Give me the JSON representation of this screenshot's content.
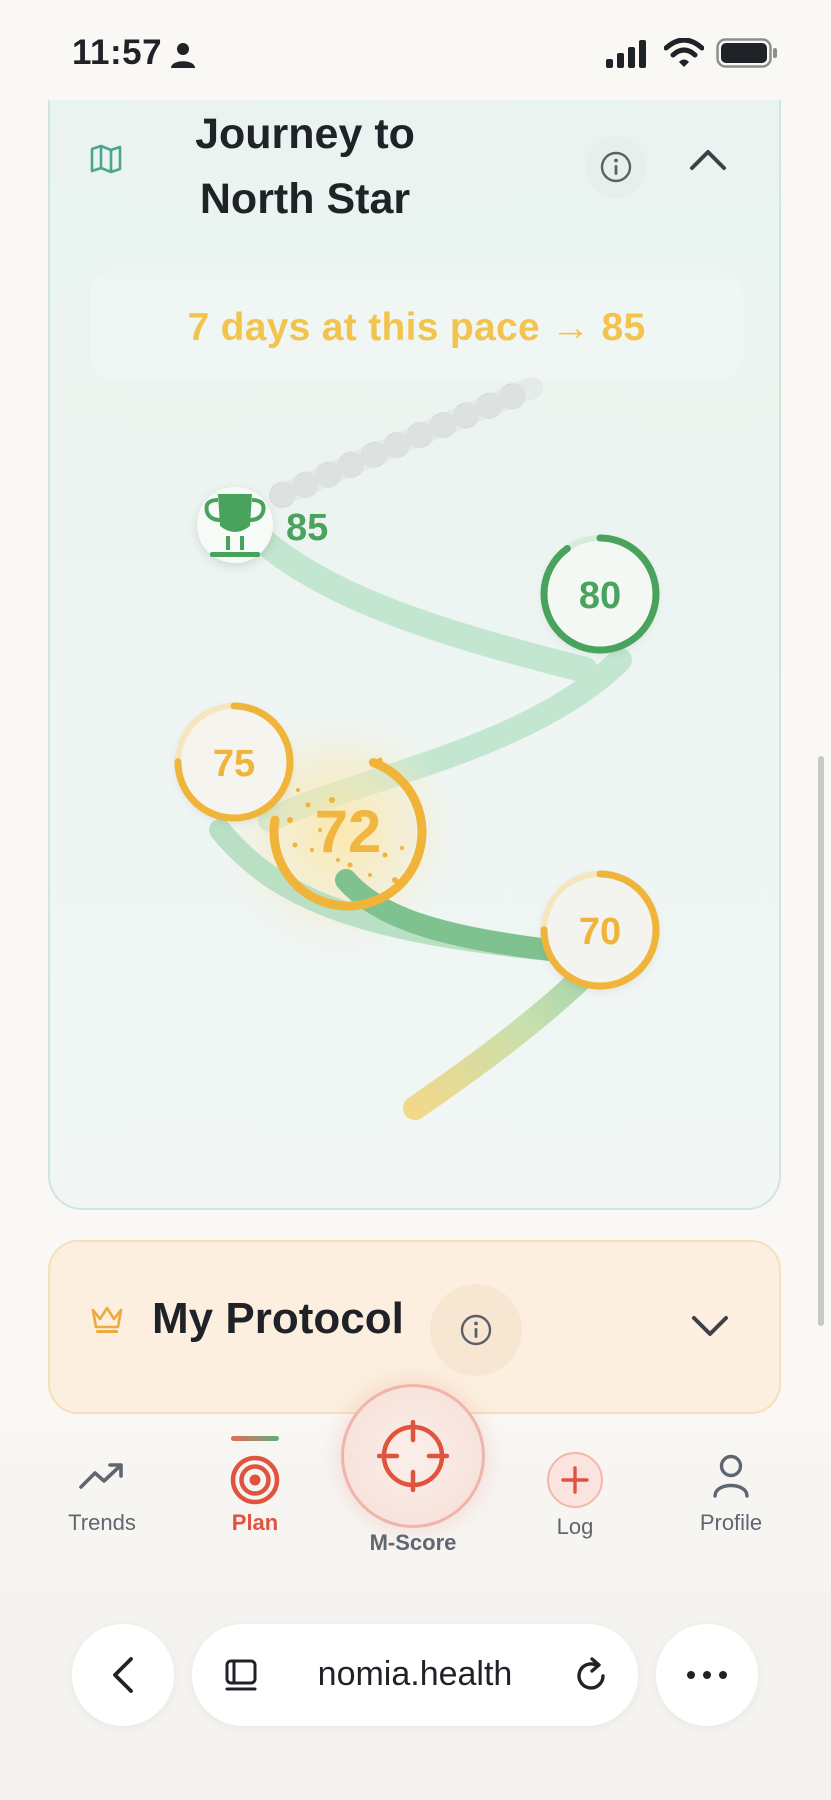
{
  "status_bar": {
    "time": "11:57"
  },
  "journey": {
    "title": "Journey to North Star",
    "projection": "7 days at this pace → 85",
    "goal_score": "85",
    "milestones": [
      {
        "label": "80",
        "progress": 0.9,
        "color": "#4aa35c"
      },
      {
        "label": "75",
        "progress": 0.75,
        "color": "#f0b43a"
      },
      {
        "label": "72",
        "progress": 0.72,
        "color": "#f0b43a",
        "current": true
      },
      {
        "label": "70",
        "progress": 0.75,
        "color": "#f0b43a"
      }
    ],
    "colors": {
      "green": "#4aa35c",
      "amber": "#f0b43a",
      "path_light": "#bfe2cc",
      "path_dark": "#7fc290"
    }
  },
  "protocol": {
    "title": "My Protocol"
  },
  "nav": {
    "trends": "Trends",
    "plan": "Plan",
    "mscore": "M-Score",
    "log": "Log",
    "profile": "Profile",
    "active": "plan",
    "accent": "#e0533f"
  },
  "browser": {
    "url": "nomia.health"
  }
}
